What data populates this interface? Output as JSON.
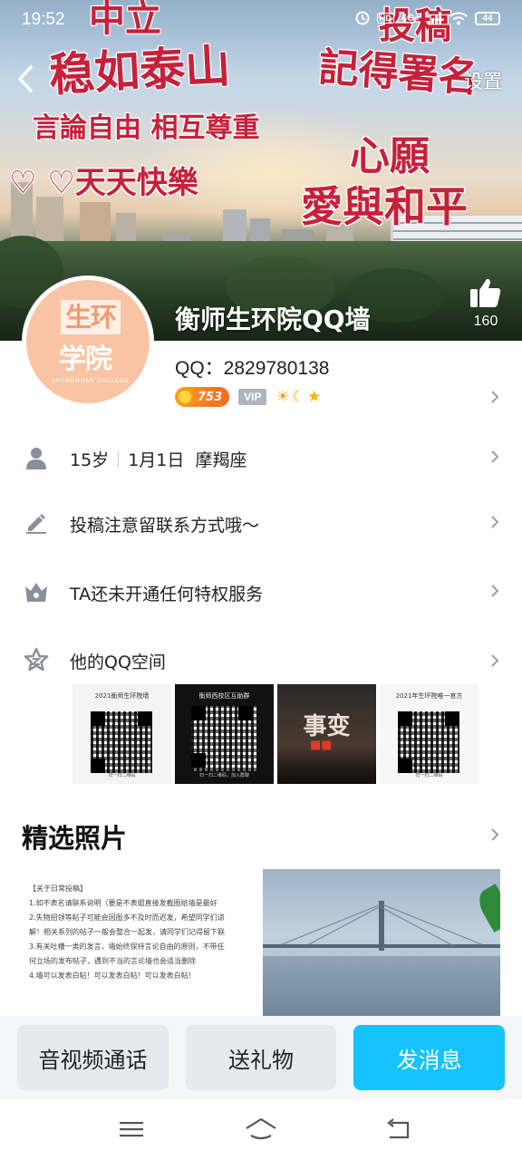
{
  "status_bar": {
    "time": "19:52",
    "network": "4G+",
    "battery": "44"
  },
  "header": {
    "settings_label": "设置"
  },
  "cover_texts": [
    "中立",
    "稳如泰山",
    "言論自由 相互尊重",
    "♡ ♡天天快樂",
    "投稿",
    "記得署名",
    "心願",
    "愛與和平"
  ],
  "profile": {
    "name": "衡师生环院QQ墙",
    "likes": "160",
    "qq_label": "QQ：2829780138",
    "level_value": "753",
    "vip_label": "VIP",
    "level_icons": [
      "sun-icon",
      "moon-icon",
      "star-icon"
    ],
    "avatar_text_top": "生环",
    "avatar_text_bottom": "学院",
    "avatar_subtext": "SHENGHUAN COLLEGE"
  },
  "info_rows": {
    "age": "15岁",
    "birthday": "1月1日",
    "zodiac": "摩羯座",
    "signature": "投稿注意留联系方式哦～",
    "privilege": "TA还未开通任何特权服务",
    "qzone": "他的QQ空间"
  },
  "qzone_thumbs": [
    {
      "caption": "2021衡师生环院墙",
      "footer": "扫一扫二维码"
    },
    {
      "caption": "衡师西校区互助群",
      "footer": "扫一扫二维码，加入群聊"
    },
    {
      "caption": "事变",
      "footer": ""
    },
    {
      "caption": "2021年生环院唯一官方",
      "footer": "扫一扫二维码"
    }
  ],
  "featured": {
    "title": "精选照片",
    "note_lines": [
      "【关于日常投稿】",
      "1.如不表名请联系说明（要是不表姐直接发截图给墙是最好",
      "2.失物招领等帖子可能会因图多不及时而迟发，希望同学们谅",
      "解！相关系列的帖子一般会整合一起发，请同学们记得留下联",
      "3.有关吐槽一类的发言，墙始终保持言论自由的原则，不带任",
      "何立场的发布帖子，遇到不当的言论墙也会适当删除",
      "4.墙可以发表白帖！可以发表白帖！可以发表白帖！"
    ]
  },
  "actions": {
    "call": "音视频通话",
    "gift": "送礼物",
    "message": "发消息"
  },
  "colors": {
    "accent_blue": "#16c3ff",
    "cover_text_red": "#c8203a",
    "level_orange": "#f06a1a"
  }
}
